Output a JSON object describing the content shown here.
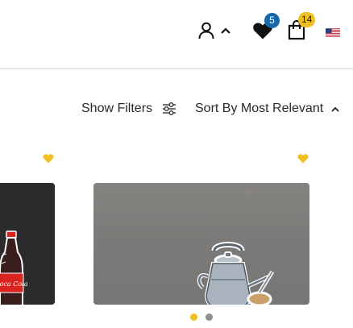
{
  "header": {
    "wishlist_count": "5",
    "cart_count": "14",
    "colors": {
      "wishlist_badge": "#1668a8",
      "cart_badge": "#f0c020"
    },
    "icons": [
      "user-icon",
      "chevron-up-icon",
      "heart-icon",
      "shopping-bag-icon",
      "us-flag-icon"
    ]
  },
  "toolbar": {
    "show_filters_label": "Show Filters",
    "sort_label": "Sort By Most Relevant"
  },
  "products": [
    {
      "image": "coca-cola-bottle-sticker",
      "wishlist_icon": "heart-icon"
    },
    {
      "image": "kettle-sticker",
      "wishlist_icon": "heart-icon"
    }
  ],
  "carousel": {
    "pages": 2,
    "active": 1
  },
  "colors": {
    "accent": "#f0c020",
    "divider": "#d6d6d6"
  }
}
